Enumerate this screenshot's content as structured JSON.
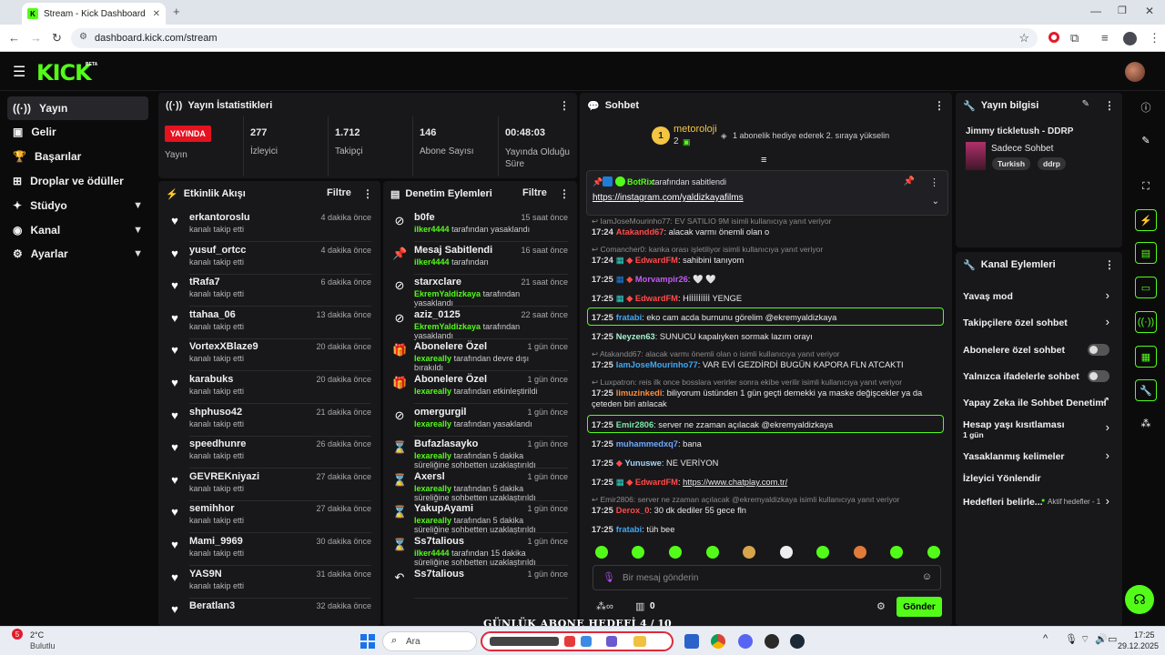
{
  "browser": {
    "tab_title": "Stream - Kick Dashboard",
    "url": "dashboard.kick.com/stream"
  },
  "kick": {
    "logo": "KICK",
    "beta": "BETA"
  },
  "sidebar": {
    "items": [
      {
        "label": "Yayın",
        "icon": "live-icon"
      },
      {
        "label": "Gelir",
        "icon": "revenue-icon"
      },
      {
        "label": "Başarılar",
        "icon": "trophy-icon"
      },
      {
        "label": "Droplar ve ödüller",
        "icon": "drops-icon"
      },
      {
        "label": "Stüdyo",
        "icon": "studio-icon"
      },
      {
        "label": "Kanal",
        "icon": "channel-icon"
      },
      {
        "label": "Ayarlar",
        "icon": "settings-icon"
      }
    ]
  },
  "stats": {
    "title": "Yayın İstatistikleri",
    "live_badge": "YAYINDA",
    "live_label": "Yayın",
    "viewers": "277",
    "viewers_label": "İzleyici",
    "followers": "1.712",
    "followers_label": "Takipçi",
    "subs": "146",
    "subs_label": "Abone Sayısı",
    "duration": "00:48:03",
    "duration_label": "Yayında Olduğu Süre"
  },
  "activity": {
    "title": "Etkinlik Akışı",
    "filter": "Filtre",
    "items": [
      {
        "name": "erkantoroslu",
        "sub": "kanalı takip etti",
        "time": "4 dakika önce"
      },
      {
        "name": "yusuf_ortcc",
        "sub": "kanalı takip etti",
        "time": "4 dakika önce"
      },
      {
        "name": "tRafa7",
        "sub": "kanalı takip etti",
        "time": "6 dakika önce"
      },
      {
        "name": "ttahaa_06",
        "sub": "kanalı takip etti",
        "time": "13 dakika önce"
      },
      {
        "name": "VortexXBlaze9",
        "sub": "kanalı takip etti",
        "time": "20 dakika önce"
      },
      {
        "name": "karabuks",
        "sub": "kanalı takip etti",
        "time": "20 dakika önce"
      },
      {
        "name": "shphuso42",
        "sub": "kanalı takip etti",
        "time": "21 dakika önce"
      },
      {
        "name": "speedhunre",
        "sub": "kanalı takip etti",
        "time": "26 dakika önce"
      },
      {
        "name": "GEVREKniyazi",
        "sub": "kanalı takip etti",
        "time": "27 dakika önce"
      },
      {
        "name": "semihhor",
        "sub": "kanalı takip etti",
        "time": "27 dakika önce"
      },
      {
        "name": "Mami_9969",
        "sub": "kanalı takip etti",
        "time": "30 dakika önce"
      },
      {
        "name": "YAS9N",
        "sub": "kanalı takip etti",
        "time": "31 dakika önce"
      },
      {
        "name": "Beratlan3",
        "sub": "",
        "time": "32 dakika önce"
      }
    ]
  },
  "moderation": {
    "title": "Denetim Eylemleri",
    "filter": "Filtre",
    "items": [
      {
        "icon": "ban-icon",
        "name": "b0fe",
        "by": "ilker4444",
        "rest": "tarafından yasaklandı",
        "rest2": "",
        "time": "15 saat önce"
      },
      {
        "icon": "pin-icon",
        "name": "Mesaj Sabitlendi",
        "by": "ilker4444",
        "rest": "tarafından",
        "rest2": "",
        "time": "16 saat önce"
      },
      {
        "icon": "ban-icon",
        "name": "starxclare",
        "by": "EkremYaldizkaya",
        "rest": "tarafından yasaklandı",
        "rest2": "",
        "time": "21 saat önce"
      },
      {
        "icon": "ban-icon",
        "name": "aziz_0125",
        "by": "EkremYaldizkaya",
        "rest": "tarafından yasaklandı",
        "rest2": "",
        "time": "22 saat önce"
      },
      {
        "icon": "gift-icon",
        "name": "Abonelere Özel",
        "by": "lexareally",
        "rest": "tarafından devre dışı bırakıldı",
        "rest2": "",
        "time": "1 gün önce"
      },
      {
        "icon": "gift-icon",
        "name": "Abonelere Özel",
        "by": "lexareally",
        "rest": "tarafından etkinleştirildi",
        "rest2": "",
        "time": "1 gün önce"
      },
      {
        "icon": "ban-icon",
        "name": "omergurgil",
        "by": "lexareally",
        "rest": "tarafından yasaklandı",
        "rest2": "",
        "time": "1 gün önce"
      },
      {
        "icon": "hourglass-icon",
        "name": "Bufazlasayko",
        "by": "lexareally",
        "rest": "tarafından 5 dakika süreliğine",
        "rest2": "sohbetten uzaklaştırıldı",
        "time": "1 gün önce"
      },
      {
        "icon": "hourglass-icon",
        "name": "Axersl",
        "by": "lexareally",
        "rest": "tarafından 5 dakika süreliğine",
        "rest2": "sohbetten uzaklaştırıldı",
        "time": "1 gün önce"
      },
      {
        "icon": "hourglass-icon",
        "name": "YakupAyami",
        "by": "lexareally",
        "rest": "tarafından 5 dakika süreliğine",
        "rest2": "sohbetten uzaklaştırıldı",
        "time": "1 gün önce"
      },
      {
        "icon": "hourglass-icon",
        "name": "Ss7talious",
        "by": "ilker4444",
        "rest": "tarafından 15 dakika süreliğine",
        "rest2": "sohbetten uzaklaştırıldı",
        "time": "1 gün önce"
      },
      {
        "icon": "undo-icon",
        "name": "Ss7talious",
        "by": "",
        "rest": "",
        "rest2": "",
        "time": "1 gün önce"
      }
    ]
  },
  "chat": {
    "title": "Sohbet",
    "top_gifter": "metorolojі",
    "top_gifter_count": "2",
    "top_gifter_rank": "1",
    "gift_msg": "1 abonelik hediye ederek 2. sıraya yükselin",
    "pinned_by": "BotRix",
    "pinned_by_rest": "tarafından sabitlendi",
    "pinned_link": "https://instagram.com/yaldizkayafilms",
    "input_placeholder": "Bir mesaj gönderin",
    "send": "Gönder",
    "bottom_count": "0"
  },
  "channel_info": {
    "title": "Yayın bilgisi",
    "stream_title": "Jimmy tickletush - DDRP",
    "category": "Sadece Sohbet",
    "tags": [
      "Turkish",
      "ddrp"
    ]
  },
  "channel_actions": {
    "title": "Kanal Eylemleri",
    "items": [
      "Yavaş mod",
      "Takipçilere özel sohbet",
      "Abonelere özel sohbet",
      "Yalnızca ifadelerle sohbet",
      "Yapay Zeka ile Sohbet Denetimi",
      "Hesap yaşı kısıtlaması",
      "Yasaklanmış kelimeler",
      "İzleyici Yönlendir",
      "Hedefleri belirle..."
    ],
    "account_age_sub": "1 gün",
    "goals_sub": "Aktif hedefler - 1"
  },
  "overlay_text": "GÜNLÜK ABONE HEDEFİ",
  "overlay_progress": "4 / 10",
  "taskbar": {
    "weather_temp": "2°C",
    "weather_label": "Bulutlu",
    "weather_badge": "5",
    "search": "Ara",
    "time": "17:25",
    "date": "29.12.2025"
  },
  "colors": {
    "accent": "#53fc18",
    "panel": "#18181b",
    "bg": "#0b0b0c"
  }
}
